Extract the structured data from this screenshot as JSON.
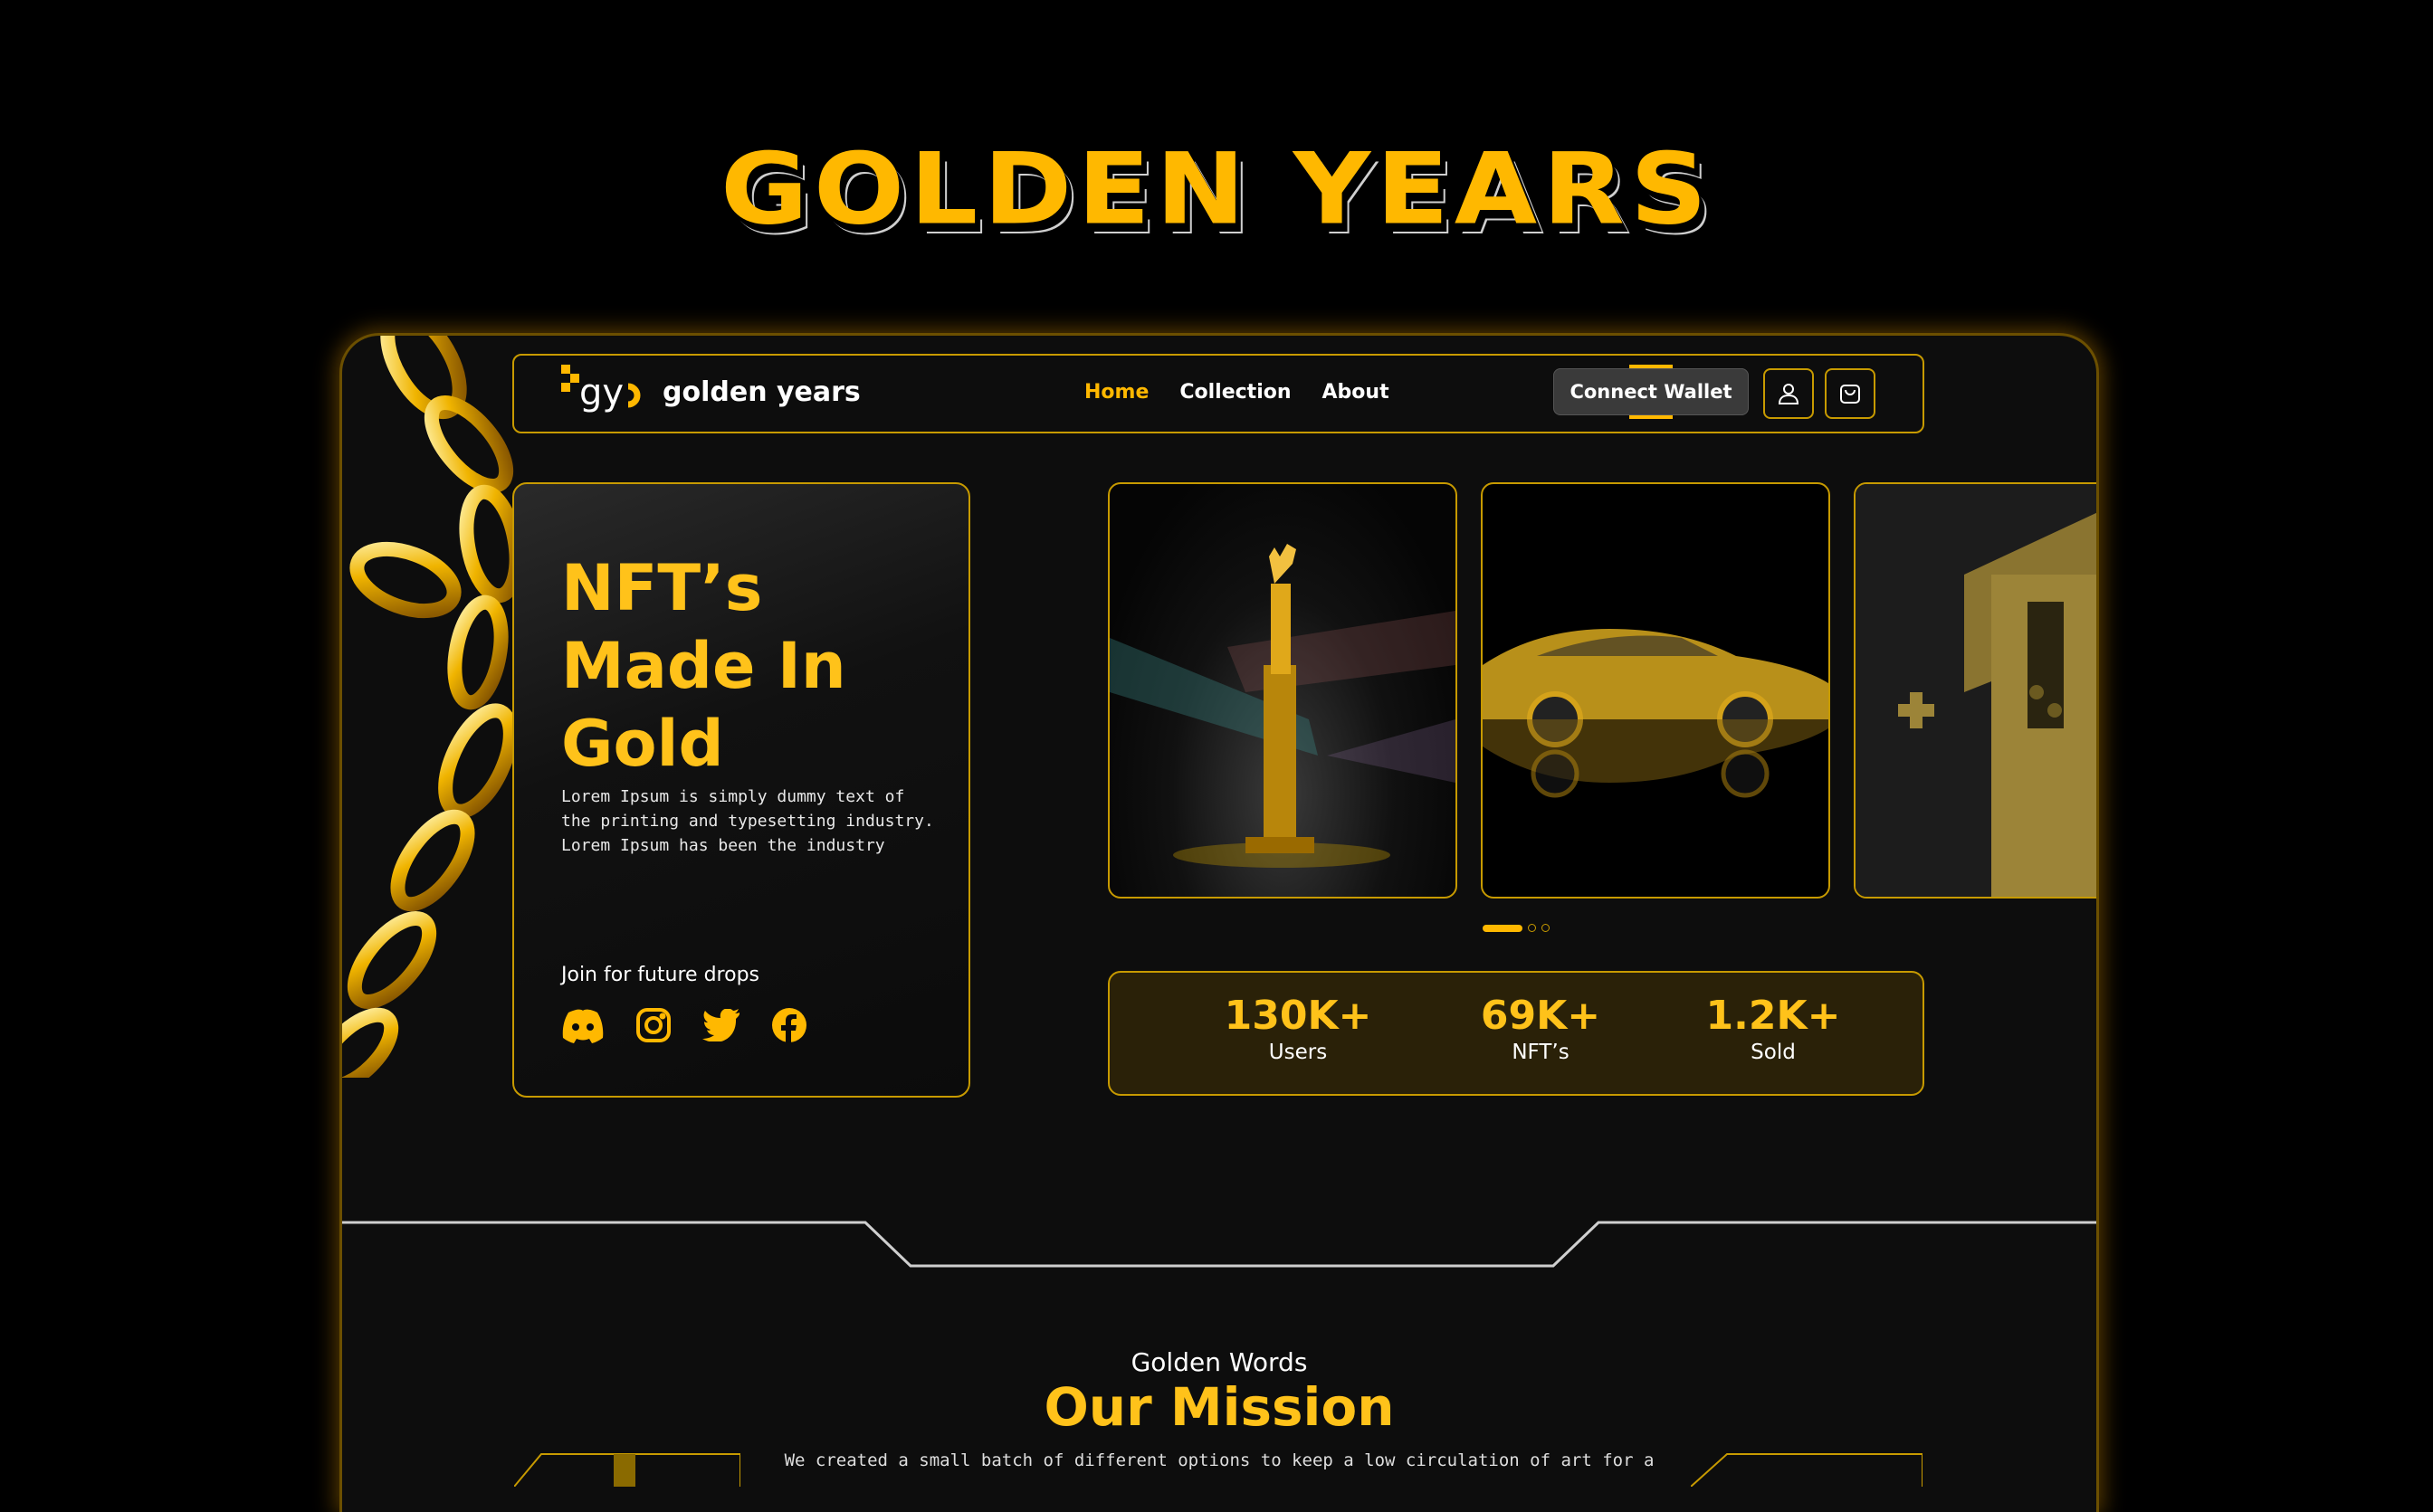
{
  "hero": {
    "title": "GOLDEN YEARS"
  },
  "nav": {
    "logo_mark": "gy",
    "brand_name": "golden years",
    "links": [
      "Home",
      "Collection",
      "About"
    ],
    "active_link": "Home",
    "connect_wallet": "Connect Wallet",
    "profile_icon": "user-icon",
    "cart_icon": "shopping-bag-icon"
  },
  "hero_card": {
    "heading": [
      "NFT’s",
      "Made In",
      "Gold"
    ],
    "description": [
      "Lorem Ipsum is simply dummy text of",
      "the printing and typesetting industry.",
      "Lorem Ipsum has been the industry"
    ],
    "join_label": "Join for future drops",
    "social_icons": [
      "discord-icon",
      "instagram-icon",
      "twitter-icon",
      "facebook-icon"
    ]
  },
  "gallery": {
    "items": [
      "gold-statue-image",
      "gold-car-image",
      "gold-gameboy-image"
    ],
    "slider_position": 1,
    "slider_count": 3
  },
  "stats": [
    {
      "value": "130K+",
      "label": "Users"
    },
    {
      "value": "69K+",
      "label": "NFT’s"
    },
    {
      "value": "1.2K+",
      "label": "Sold"
    }
  ],
  "mission": {
    "kicker": "Golden Words",
    "title": "Our Mission",
    "text": "We created a small batch of different options to keep a low circulation of art for a"
  },
  "colors": {
    "accent": "#ffb800",
    "gold_text": "#ffc21a",
    "border": "#c79a00",
    "background": "#0d0d0d",
    "page": "#000000"
  }
}
